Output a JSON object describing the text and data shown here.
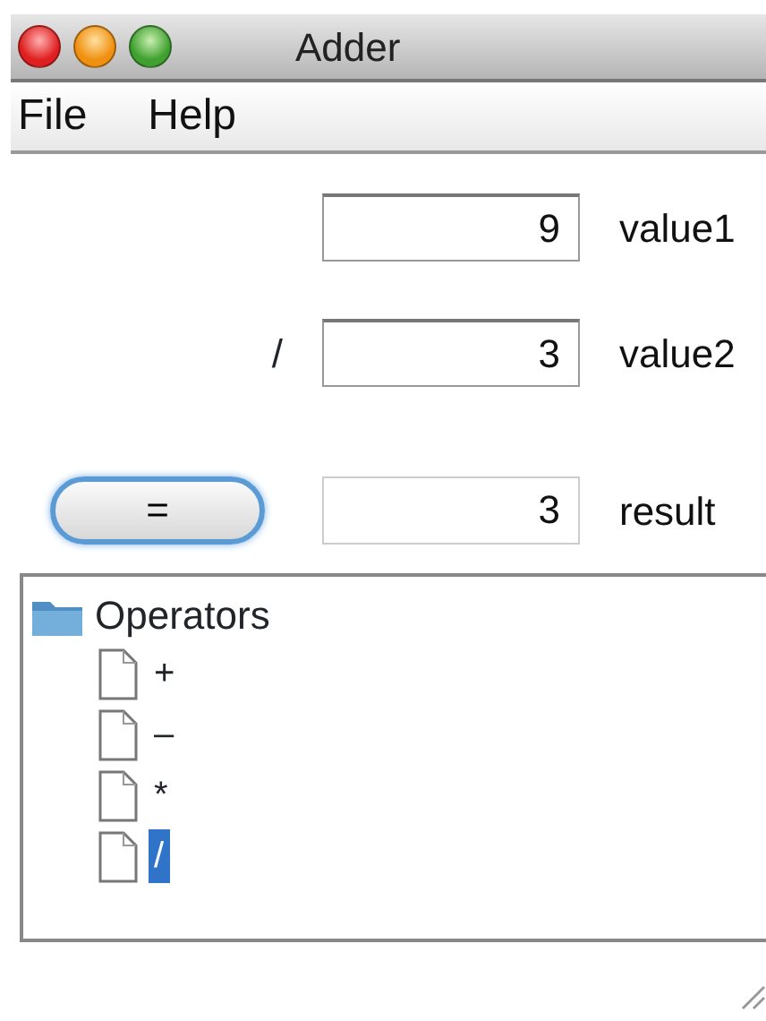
{
  "window": {
    "title": "Adder"
  },
  "menu": [
    "File",
    "Help"
  ],
  "fields": [
    {
      "kind": "input",
      "value": "9",
      "label": "value1"
    },
    {
      "kind": "input",
      "operator": "/",
      "value": "3",
      "label": "value2"
    },
    {
      "kind": "result",
      "button": "=",
      "value": "3",
      "label": "result"
    }
  ],
  "tree": {
    "label": "Operators",
    "children": [
      {
        "label": "+",
        "selected": false
      },
      {
        "label": "–",
        "selected": false
      },
      {
        "label": "*",
        "selected": false
      },
      {
        "label": "/",
        "selected": true
      }
    ]
  }
}
